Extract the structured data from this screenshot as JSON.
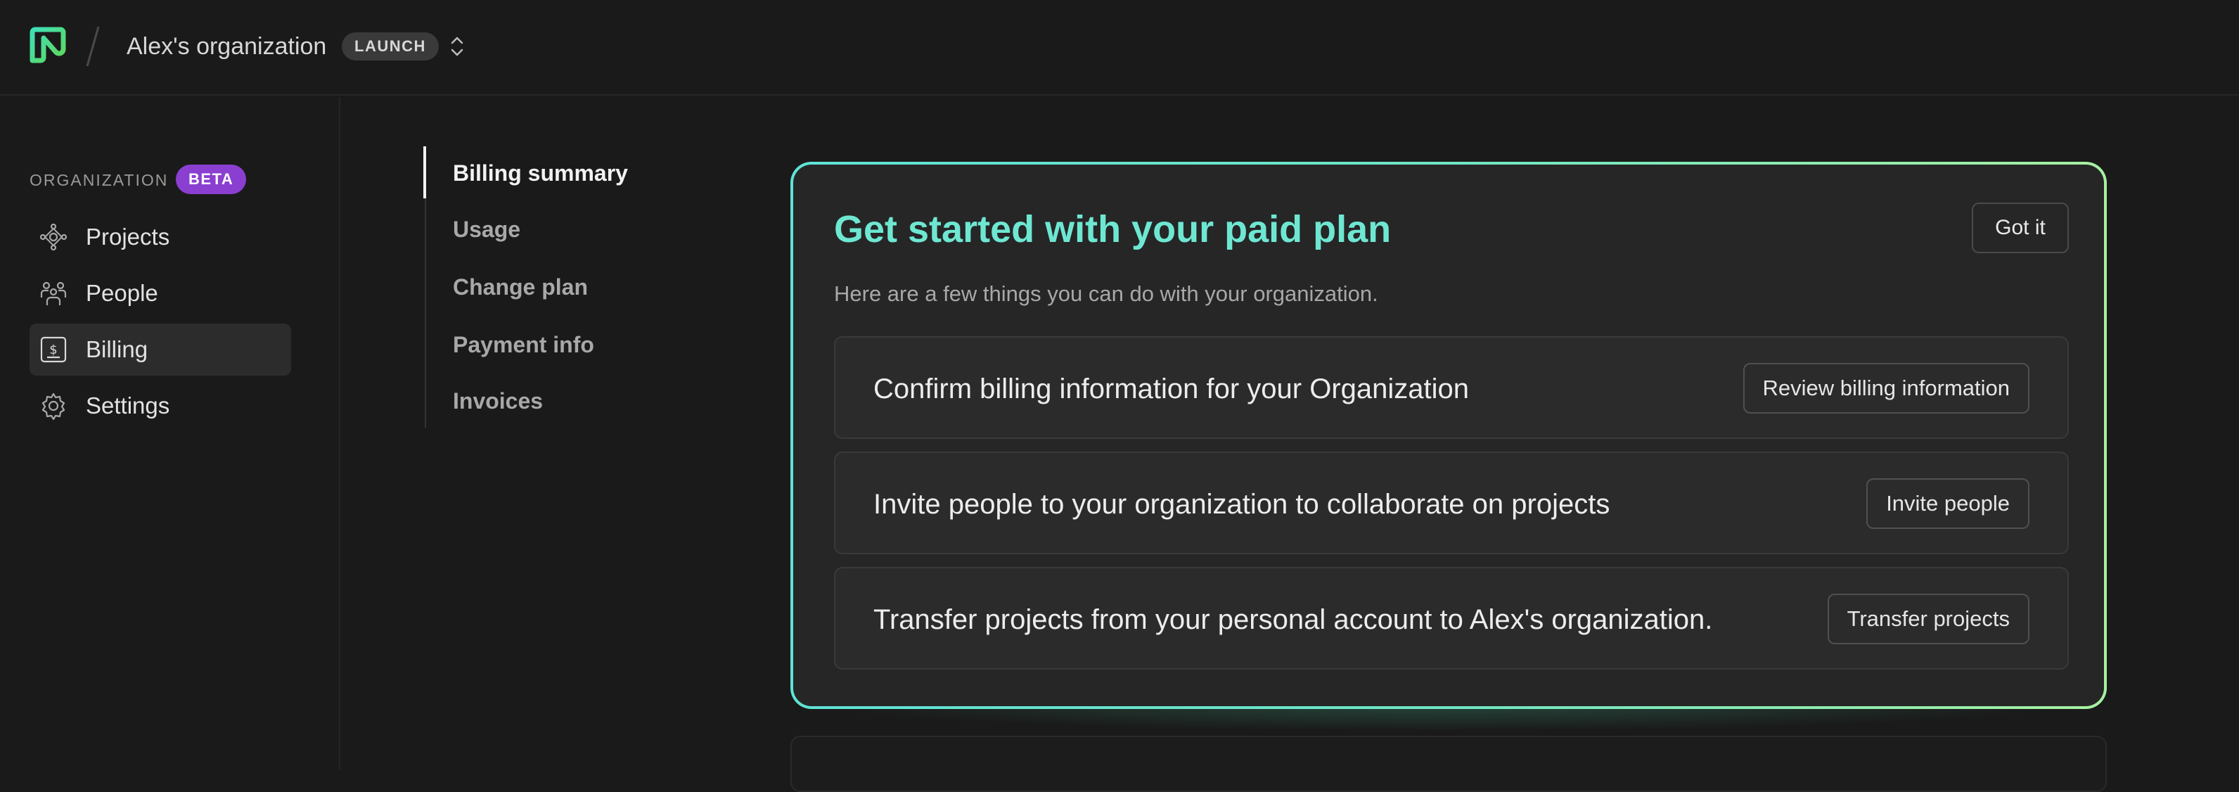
{
  "header": {
    "org_name": "Alex's organization",
    "plan_badge": "LAUNCH",
    "icons": [
      "neon-logo",
      "slash-separator",
      "chevrons-up-down-icon"
    ]
  },
  "sidebar": {
    "section_label": "ORGANIZATION",
    "section_badge": "BETA",
    "items": [
      {
        "label": "Projects",
        "icon": "projects-icon",
        "active": false
      },
      {
        "label": "People",
        "icon": "people-icon",
        "active": false
      },
      {
        "label": "Billing",
        "icon": "billing-icon",
        "active": true
      },
      {
        "label": "Settings",
        "icon": "gear-icon",
        "active": false
      }
    ]
  },
  "subnav": {
    "items": [
      {
        "label": "Billing summary",
        "active": true
      },
      {
        "label": "Usage",
        "active": false
      },
      {
        "label": "Change plan",
        "active": false
      },
      {
        "label": "Payment info",
        "active": false
      },
      {
        "label": "Invoices",
        "active": false
      }
    ]
  },
  "onboarding_card": {
    "title": "Get started with your paid plan",
    "dismiss_label": "Got it",
    "subtitle": "Here are a few things you can do with your organization.",
    "tasks": [
      {
        "text": "Confirm billing information for your Organization",
        "button": "Review billing information"
      },
      {
        "text": "Invite people to your organization to collaborate on projects",
        "button": "Invite people"
      },
      {
        "text": "Transfer projects from your personal account to Alex's organization.",
        "button": "Transfer projects"
      }
    ]
  },
  "colors": {
    "background": "#1a1a1a",
    "card_title": "#6ee7d2",
    "card_border_start": "#5fe3d6",
    "card_border_end": "#a6f0a0",
    "beta_badge": "#8a3fd1",
    "logo_start": "#3ee0b8",
    "logo_end": "#5fd85a"
  }
}
